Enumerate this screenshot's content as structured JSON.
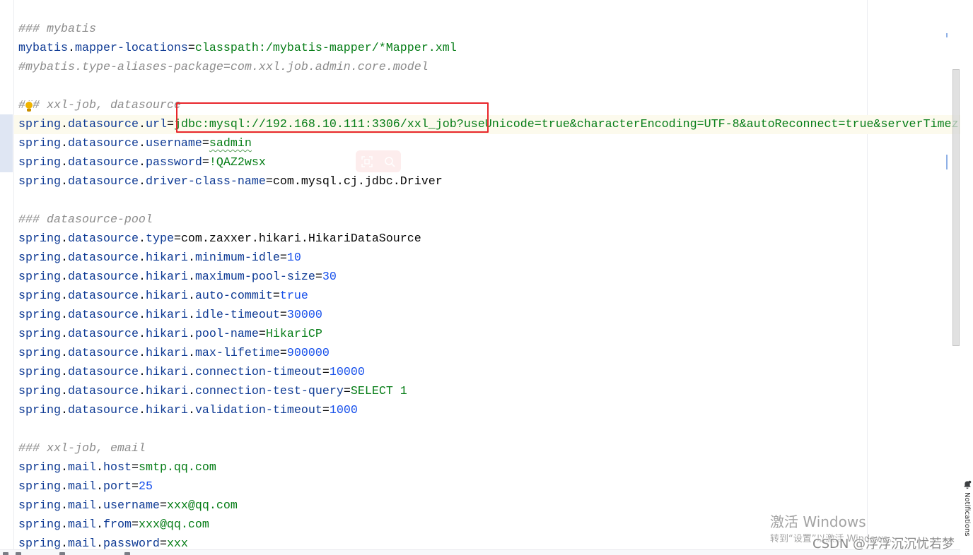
{
  "colors": {
    "key": "#0e3a94",
    "string": "#067d17",
    "number": "#1750eb",
    "comment": "#8c8c8c",
    "text": "#080808",
    "current_line": "#fcfaed",
    "annotation_box": "#e8262b",
    "typo_underline": "#5aa05a",
    "intention_bulb": "#f0b400"
  },
  "icons": {
    "intention": "lightbulb-icon",
    "notifications": "bell-icon",
    "overlay_tools": [
      "scan-icon",
      "search-icon"
    ]
  },
  "editor": {
    "lines": [
      {
        "tokens": [
          {
            "kind": "comment",
            "text": "### mybatis"
          }
        ]
      },
      {
        "tokens": [
          {
            "kind": "key",
            "text": "mybatis.mapper-locations"
          },
          {
            "kind": "separator",
            "text": "="
          },
          {
            "kind": "string",
            "text": "classpath:/mybatis-mapper/*Mapper.xml"
          }
        ]
      },
      {
        "tokens": [
          {
            "kind": "comment",
            "text": "#mybatis.type-aliases-package=com.xxl.job.admin.core.model"
          }
        ]
      },
      {
        "tokens": []
      },
      {
        "tokens": [
          {
            "kind": "comment",
            "text": "### xxl-job, datasource"
          }
        ]
      },
      {
        "current": true,
        "tokens": [
          {
            "kind": "key",
            "text": "spring.datasource.url"
          },
          {
            "kind": "separator",
            "text": "="
          },
          {
            "kind": "string",
            "text": "jdbc:mysql://192.168.10.111:3306/xxl_job?useUnicode=true&characterEncoding=UTF-8&autoReconnect=true&serverTimez"
          }
        ]
      },
      {
        "tokens": [
          {
            "kind": "key",
            "text": "spring.datasource.username"
          },
          {
            "kind": "separator",
            "text": "="
          },
          {
            "kind": "string",
            "text": "sadmin",
            "typo": true
          }
        ]
      },
      {
        "tokens": [
          {
            "kind": "key",
            "text": "spring.datasource.password"
          },
          {
            "kind": "separator",
            "text": "="
          },
          {
            "kind": "string",
            "text": "!QAZ2wsx"
          }
        ]
      },
      {
        "tokens": [
          {
            "kind": "key",
            "text": "spring.datasource.driver-class-name"
          },
          {
            "kind": "separator",
            "text": "="
          },
          {
            "kind": "class",
            "text": "com.mysql.cj.jdbc.Driver"
          }
        ]
      },
      {
        "tokens": []
      },
      {
        "tokens": [
          {
            "kind": "comment",
            "text": "### datasource-pool"
          }
        ]
      },
      {
        "tokens": [
          {
            "kind": "key",
            "text": "spring.datasource.type"
          },
          {
            "kind": "separator",
            "text": "="
          },
          {
            "kind": "class",
            "text": "com.zaxxer.hikari.HikariDataSource"
          }
        ]
      },
      {
        "tokens": [
          {
            "kind": "key",
            "text": "spring.datasource.hikari.minimum-idle"
          },
          {
            "kind": "separator",
            "text": "="
          },
          {
            "kind": "number",
            "text": "10"
          }
        ]
      },
      {
        "tokens": [
          {
            "kind": "key",
            "text": "spring.datasource.hikari.maximum-pool-size"
          },
          {
            "kind": "separator",
            "text": "="
          },
          {
            "kind": "number",
            "text": "30"
          }
        ]
      },
      {
        "tokens": [
          {
            "kind": "key",
            "text": "spring.datasource.hikari.auto-commit"
          },
          {
            "kind": "separator",
            "text": "="
          },
          {
            "kind": "boolean",
            "text": "true"
          }
        ]
      },
      {
        "tokens": [
          {
            "kind": "key",
            "text": "spring.datasource.hikari.idle-timeout"
          },
          {
            "kind": "separator",
            "text": "="
          },
          {
            "kind": "number",
            "text": "30000"
          }
        ]
      },
      {
        "tokens": [
          {
            "kind": "key",
            "text": "spring.datasource.hikari.pool-name"
          },
          {
            "kind": "separator",
            "text": "="
          },
          {
            "kind": "string",
            "text": "HikariCP"
          }
        ]
      },
      {
        "tokens": [
          {
            "kind": "key",
            "text": "spring.datasource.hikari.max-lifetime"
          },
          {
            "kind": "separator",
            "text": "="
          },
          {
            "kind": "number",
            "text": "900000"
          }
        ]
      },
      {
        "tokens": [
          {
            "kind": "key",
            "text": "spring.datasource.hikari.connection-timeout"
          },
          {
            "kind": "separator",
            "text": "="
          },
          {
            "kind": "number",
            "text": "10000"
          }
        ]
      },
      {
        "tokens": [
          {
            "kind": "key",
            "text": "spring.datasource.hikari.connection-test-query"
          },
          {
            "kind": "separator",
            "text": "="
          },
          {
            "kind": "string",
            "text": "SELECT 1"
          }
        ]
      },
      {
        "tokens": [
          {
            "kind": "key",
            "text": "spring.datasource.hikari.validation-timeout"
          },
          {
            "kind": "separator",
            "text": "="
          },
          {
            "kind": "number",
            "text": "1000"
          }
        ]
      },
      {
        "tokens": []
      },
      {
        "tokens": [
          {
            "kind": "comment",
            "text": "### xxl-job, email"
          }
        ]
      },
      {
        "tokens": [
          {
            "kind": "key",
            "text": "spring.mail.host"
          },
          {
            "kind": "separator",
            "text": "="
          },
          {
            "kind": "string",
            "text": "smtp.qq.com"
          }
        ]
      },
      {
        "tokens": [
          {
            "kind": "key",
            "text": "spring.mail.port"
          },
          {
            "kind": "separator",
            "text": "="
          },
          {
            "kind": "number",
            "text": "25"
          }
        ]
      },
      {
        "tokens": [
          {
            "kind": "key",
            "text": "spring.mail.username"
          },
          {
            "kind": "separator",
            "text": "="
          },
          {
            "kind": "string",
            "text": "xxx@qq.com"
          }
        ]
      },
      {
        "tokens": [
          {
            "kind": "key",
            "text": "spring.mail.from"
          },
          {
            "kind": "separator",
            "text": "="
          },
          {
            "kind": "string",
            "text": "xxx@qq.com"
          }
        ]
      },
      {
        "tokens": [
          {
            "kind": "key",
            "text": "spring.mail.password"
          },
          {
            "kind": "separator",
            "text": "="
          },
          {
            "kind": "string",
            "text": "xxx"
          }
        ]
      }
    ]
  },
  "right_strip": {
    "notifications_label": "Notifications"
  },
  "watermarks": {
    "windows_title": "激活 Windows",
    "windows_hint": "转到“设置”以激活 Windows。",
    "csdn": "CSDN @浮浮沉沉忧若梦"
  }
}
